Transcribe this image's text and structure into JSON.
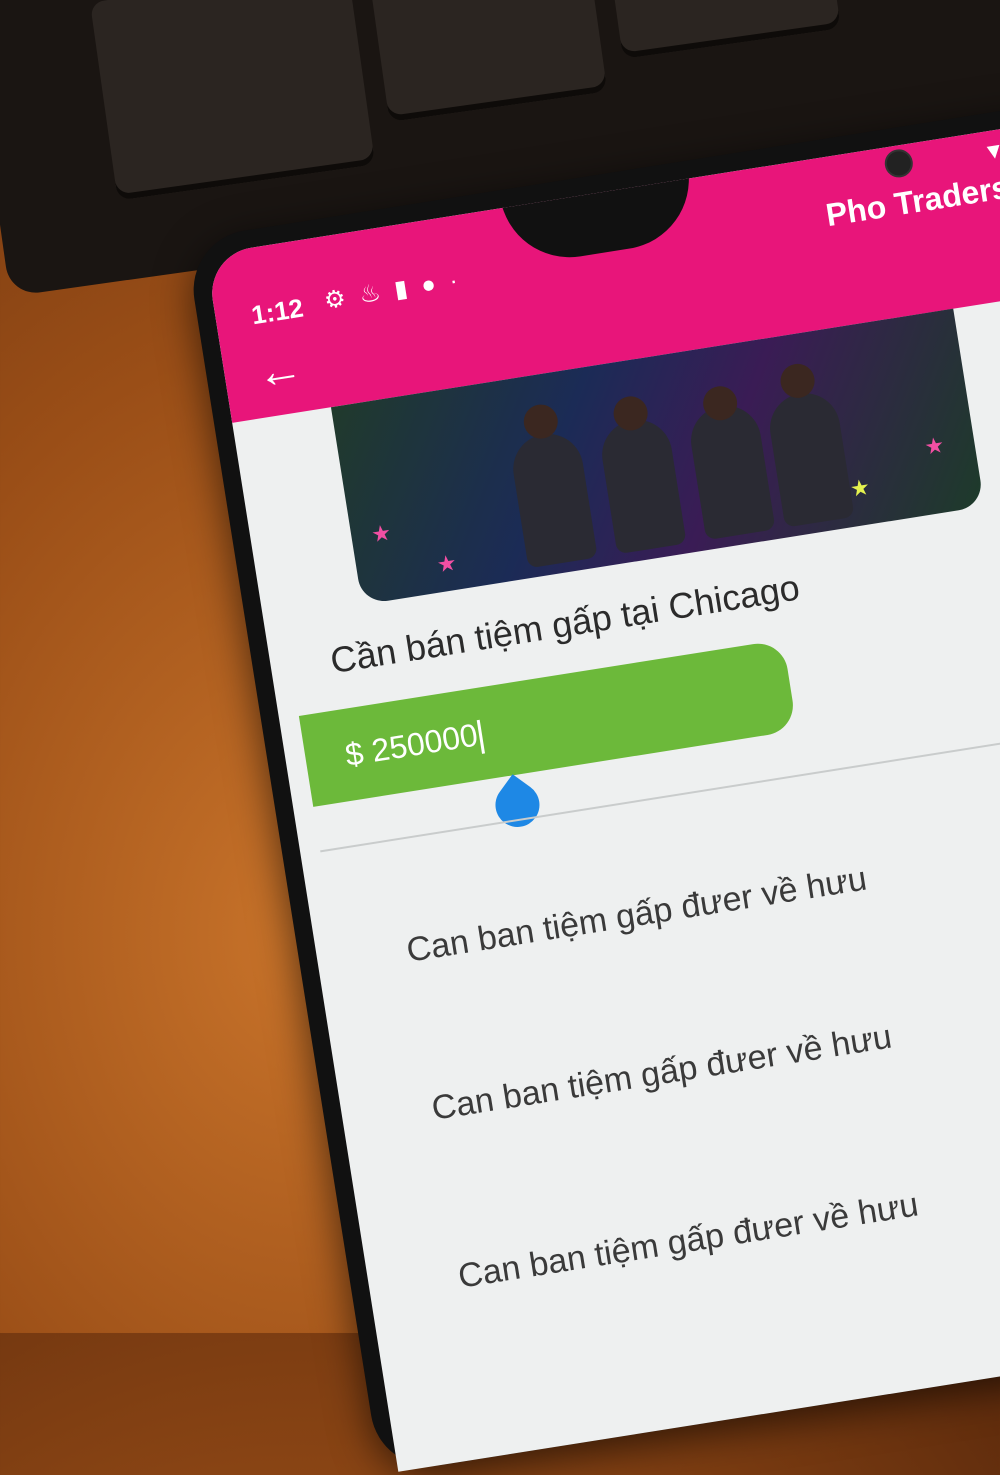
{
  "status_bar": {
    "time": "1:12",
    "icons": [
      "gear-icon",
      "cake-icon",
      "lock-icon",
      "dot-icon",
      "small-dot-icon"
    ],
    "right_icons": [
      "wifi-icon",
      "battery-icon"
    ]
  },
  "app_bar": {
    "title": "Pho Traders",
    "back_icon": "back-arrow-icon",
    "color": "#e8157a"
  },
  "listing": {
    "title": "Cần bán tiệm gấp tại Chicago",
    "price_prefix": "$",
    "price_value": "250000",
    "price_color": "#6cb93a",
    "descriptions": [
      "Can ban tiệm gấp đưer về hưu",
      "Can ban tiệm gấp đưer về hưu",
      "Can ban tiệm gấp đưer về hưu"
    ]
  }
}
